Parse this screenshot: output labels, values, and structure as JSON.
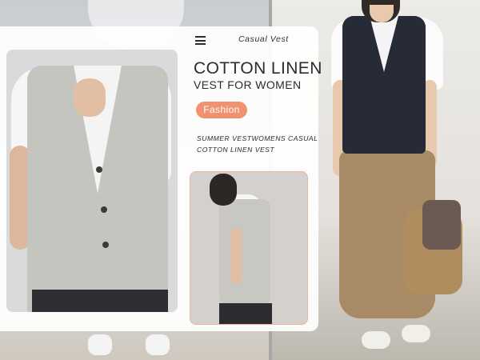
{
  "header": {
    "tagline": "Casual Vest"
  },
  "product": {
    "title_line1": "COTTON LINEN",
    "title_line2": "VEST FOR WOMEN",
    "badge": "Fashion",
    "desc_line1": "SUMMER VESTWOMENS CASUAL",
    "desc_line2": "COTTON LINEN VEST"
  },
  "icons": {
    "menu": "hamburger-menu-icon"
  },
  "colors": {
    "badge_bg": "#f0926f",
    "card_bg": "#ffffff",
    "vest_gray": "#c5c5c0",
    "vest_navy": "#262b37",
    "pants_khaki": "#a88a66"
  }
}
